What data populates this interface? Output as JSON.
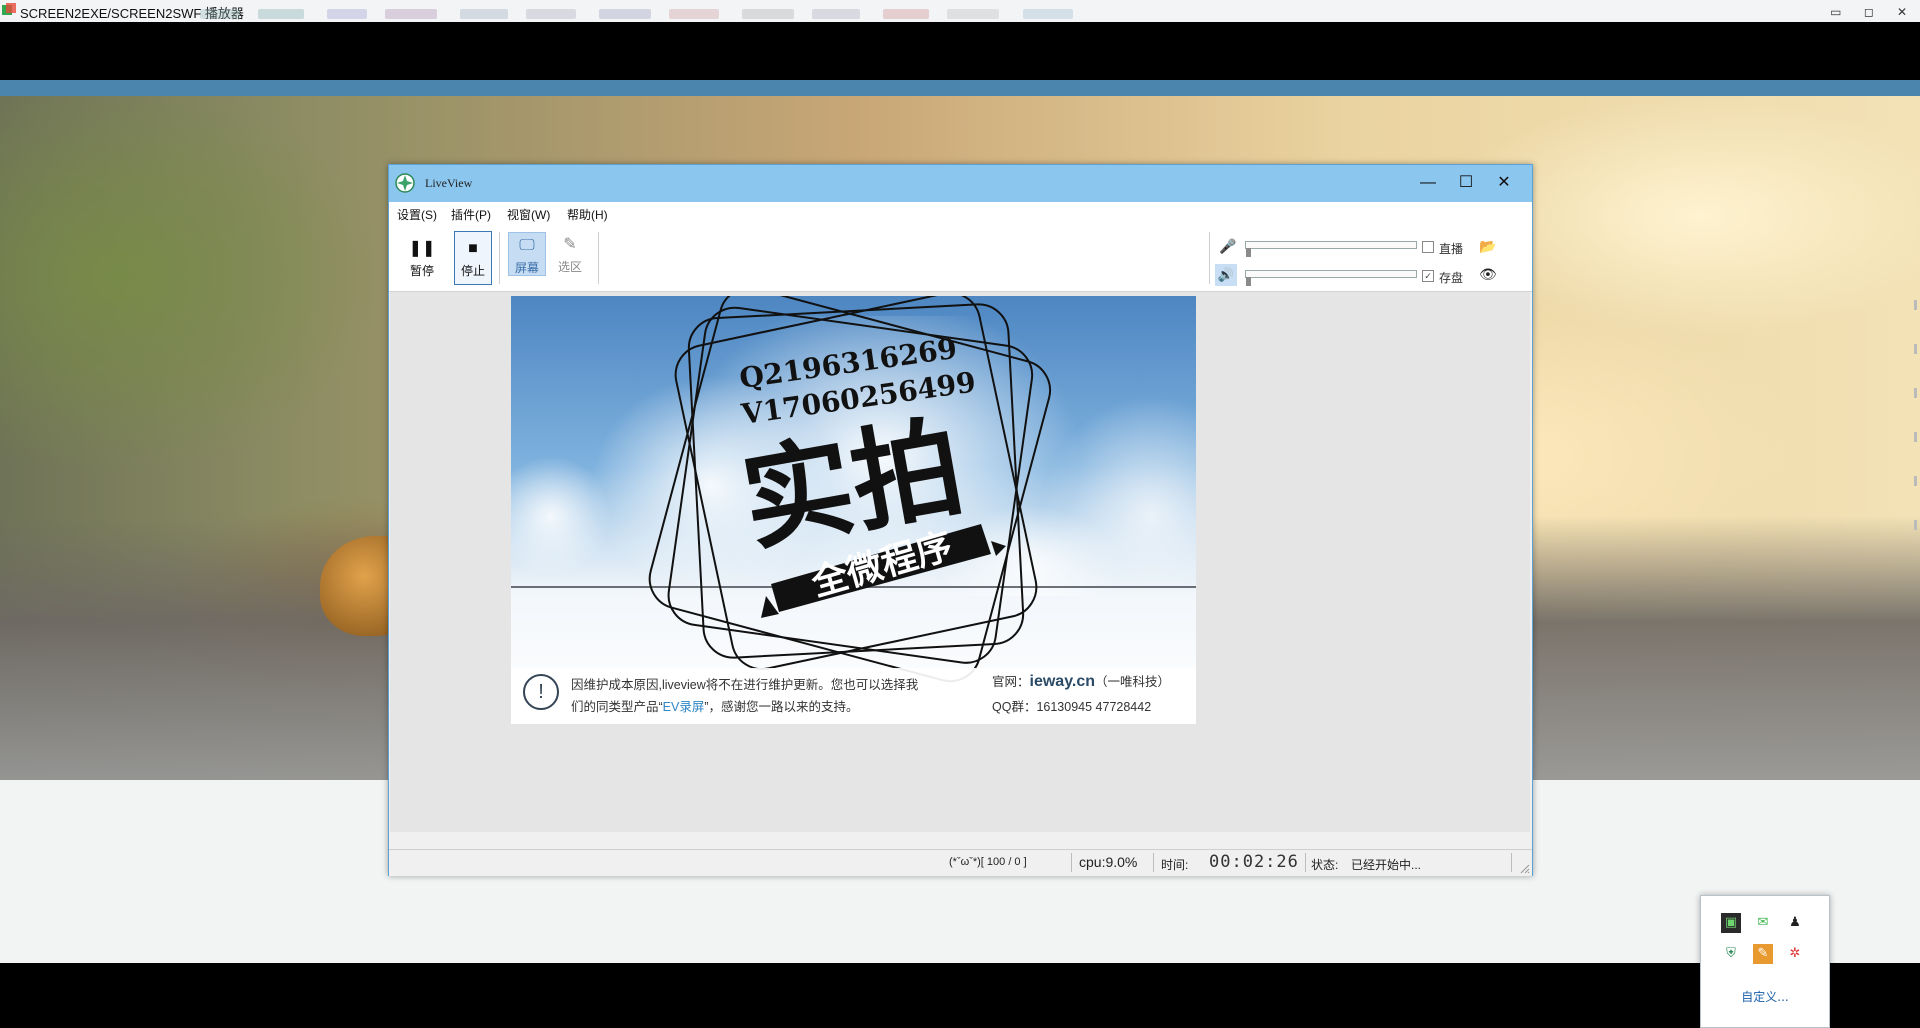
{
  "player": {
    "title": "SCREEN2EXE/SCREEN2SWF 播放器",
    "buttons": [
      "▭",
      "◻",
      "✕"
    ]
  },
  "liveview": {
    "title": "LiveView",
    "window_buttons": {
      "minimize": "—",
      "maximize": "☐",
      "close": "✕"
    },
    "menu": [
      {
        "label": "设置(S)"
      },
      {
        "label": "插件(P)"
      },
      {
        "label": "视窗(W)"
      },
      {
        "label": "帮助(H)"
      }
    ],
    "toolbar": {
      "pause_label": "暂停",
      "stop_label": "停止",
      "screen_label": "屏幕",
      "region_label": "选区"
    },
    "audio": {
      "live_label": "直播",
      "save_label": "存盘",
      "live_checked": false,
      "save_checked": true,
      "mic_level": 0.0,
      "speaker_level": 0.0
    },
    "preview": {
      "stamp_line1": "Q2196316269",
      "stamp_line2": "V17060256499",
      "stamp_main": "实拍",
      "stamp_banner": "全微程序",
      "notice_line1": "因维护成本原因,liveview将不在进行维护更新。您也可以选择我",
      "notice_line2_pre": "们的同类型产品“",
      "notice_line2_ev": "EV录屏",
      "notice_line2_post": "”，感谢您一路以来的支持。",
      "site_label": "官网：",
      "site_domain": "ieway.cn",
      "site_company": "（一唯科技）",
      "qq_group": "QQ群：16130945  47728442"
    },
    "status": {
      "face": "(*ˇωˇ*)[ 100 / 0 ]",
      "cpu": "cpu:9.0%",
      "time_label": "时间:",
      "timer": "00:02:26",
      "state_label": "状态:",
      "state_value": "已经开始中..."
    }
  },
  "tray": {
    "custom_label": "自定义..."
  },
  "colors": {
    "title_blue": "#8bc6ef",
    "accent_blue": "#3b78b7",
    "ev_blue": "#2f86c6"
  }
}
